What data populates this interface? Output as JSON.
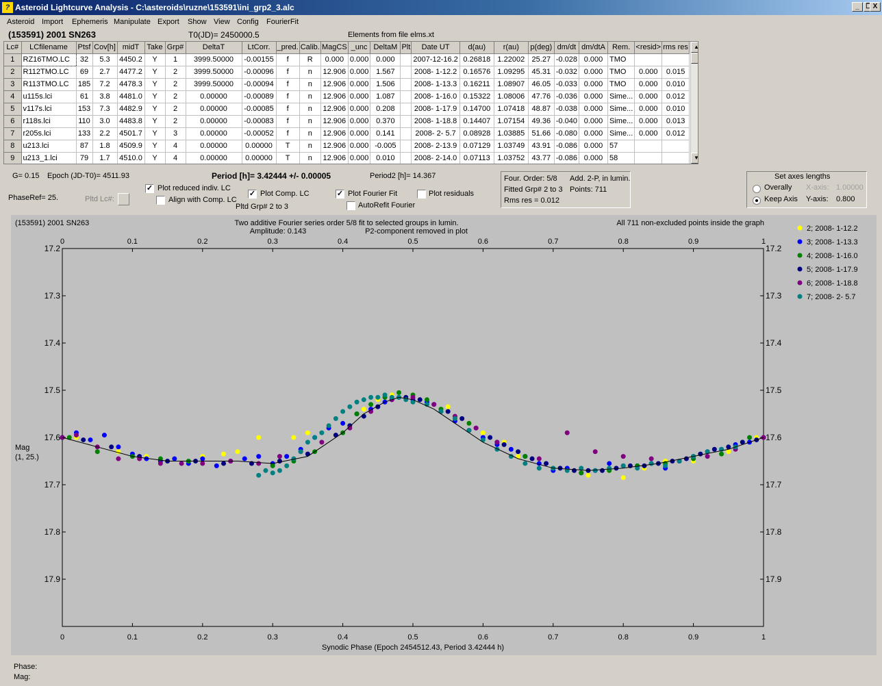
{
  "window": {
    "title": "Asteroid Lightcurve Analysis - C:\\asteroids\\ruzne\\153591\\ini_grp2_3.alc",
    "minimize": "_",
    "restore": "❐",
    "close": "X"
  },
  "menu": [
    "Asteroid",
    "Import",
    "Ephemeris",
    "Manipulate",
    "Export",
    "Show",
    "View",
    "Config",
    "FourierFit"
  ],
  "header": {
    "object": "(153591) 2001 SN263",
    "t0": "T0(JD)= 2450000.5",
    "elements": "Elements from file elms.xt"
  },
  "table": {
    "columns": [
      "Lc#",
      "LCfilename",
      "Ptsf",
      "Cov[h]",
      "midT",
      "Take",
      "Grp#",
      "DeltaT",
      "LtCorr.",
      "_pred.",
      "Calib.",
      "MagCS",
      "_unc",
      "DeltaM",
      "Plt",
      "Date UT",
      "d(au)",
      "r(au)",
      "p(deg)",
      "dm/dt",
      "dm/dtA",
      "Rem.",
      "<resid>",
      "rms res"
    ],
    "rows": [
      [
        "1",
        "RZ16TMO.LC",
        "32",
        "5.3",
        "4450.2",
        "Y",
        "1",
        "3999.50000",
        "-0.00155",
        "f",
        "R",
        "0.000",
        "0.000",
        "0.000",
        "",
        "2007-12-16.2",
        "0.26818",
        "1.22002",
        "25.27",
        "-0.028",
        "0.000",
        "TMO",
        "",
        ""
      ],
      [
        "2",
        "R112TMO.LC",
        "69",
        "2.7",
        "4477.2",
        "Y",
        "2",
        "3999.50000",
        "-0.00096",
        "f",
        "n",
        "12.906",
        "0.000",
        "1.567",
        "",
        "2008- 1-12.2",
        "0.16576",
        "1.09295",
        "45.31",
        "-0.032",
        "0.000",
        "TMO",
        "0.000",
        "0.015"
      ],
      [
        "3",
        "R113TMO.LC",
        "185",
        "7.2",
        "4478.3",
        "Y",
        "2",
        "3999.50000",
        "-0.00094",
        "f",
        "n",
        "12.906",
        "0.000",
        "1.506",
        "",
        "2008- 1-13.3",
        "0.16211",
        "1.08907",
        "46.05",
        "-0.033",
        "0.000",
        "TMO",
        "0.000",
        "0.010"
      ],
      [
        "4",
        "u115s.lci",
        "61",
        "3.8",
        "4481.0",
        "Y",
        "2",
        "0.00000",
        "-0.00089",
        "f",
        "n",
        "12.906",
        "0.000",
        "1.087",
        "",
        "2008- 1-16.0",
        "0.15322",
        "1.08006",
        "47.76",
        "-0.036",
        "0.000",
        "Sime...",
        "0.000",
        "0.012"
      ],
      [
        "5",
        "v117s.lci",
        "153",
        "7.3",
        "4482.9",
        "Y",
        "2",
        "0.00000",
        "-0.00085",
        "f",
        "n",
        "12.906",
        "0.000",
        "0.208",
        "",
        "2008- 1-17.9",
        "0.14700",
        "1.07418",
        "48.87",
        "-0.038",
        "0.000",
        "Sime...",
        "0.000",
        "0.010"
      ],
      [
        "6",
        "r118s.lci",
        "110",
        "3.0",
        "4483.8",
        "Y",
        "2",
        "0.00000",
        "-0.00083",
        "f",
        "n",
        "12.906",
        "0.000",
        "0.370",
        "",
        "2008- 1-18.8",
        "0.14407",
        "1.07154",
        "49.36",
        "-0.040",
        "0.000",
        "Sime...",
        "0.000",
        "0.013"
      ],
      [
        "7",
        "r205s.lci",
        "133",
        "2.2",
        "4501.7",
        "Y",
        "3",
        "0.00000",
        "-0.00052",
        "f",
        "n",
        "12.906",
        "0.000",
        "0.141",
        "",
        "2008- 2- 5.7",
        "0.08928",
        "1.03885",
        "51.66",
        "-0.080",
        "0.000",
        "Sime...",
        "0.000",
        "0.012"
      ],
      [
        "8",
        "u213.lci",
        "87",
        "1.8",
        "4509.9",
        "Y",
        "4",
        "0.00000",
        "0.00000",
        "T",
        "n",
        "12.906",
        "0.000",
        "-0.005",
        "",
        "2008- 2-13.9",
        "0.07129",
        "1.03749",
        "43.91",
        "-0.086",
        "0.000",
        "57",
        "",
        ""
      ],
      [
        "9",
        "u213_1.lci",
        "79",
        "1.7",
        "4510.0",
        "Y",
        "4",
        "0.00000",
        "0.00000",
        "T",
        "n",
        "12.906",
        "0.000",
        "0.010",
        "",
        "2008- 2-14.0",
        "0.07113",
        "1.03752",
        "43.77",
        "-0.086",
        "0.000",
        "58",
        "",
        ""
      ]
    ],
    "scroll_up": "▲",
    "scroll_down": "▼"
  },
  "info": {
    "g": "G= 0.15",
    "epoch": "Epoch (JD-T0)= 4511.93",
    "period": "Period [h]= 3.42444 +/- 0.00005",
    "period2": "Period2 [h]= 14.367",
    "phaseref": "PhaseRef= 25.",
    "pltd_lc": "Pltd Lc#:",
    "pltd_grp": "Pltd Grp#  2  to  3"
  },
  "options": {
    "plot_reduced": {
      "label": "Plot reduced indiv. LC",
      "checked": true
    },
    "align_comp": {
      "label": "Align with Comp. LC",
      "checked": false
    },
    "plot_comp": {
      "label": "Plot Comp. LC",
      "checked": true
    },
    "plot_fourier": {
      "label": "Plot Fourier Fit",
      "checked": true
    },
    "autorefit": {
      "label": "AutoRefit Fourier",
      "checked": false
    },
    "plot_residuals": {
      "label": "Plot residuals",
      "checked": false
    }
  },
  "fourier": {
    "order": "Four. Order:  5/8",
    "add2p": "Add. 2-P, in lumin.",
    "fitted": "Fitted Grp# 2 to 3",
    "points": "Points: 711",
    "rms": "Rms res     = 0.012"
  },
  "axes": {
    "title": "Set axes lengths",
    "overally": "Overally",
    "keep_axis": "Keep Axis",
    "selected": "keep_axis",
    "xaxis_label": "X-axis:",
    "xaxis_value": "1.00000",
    "yaxis_label": "Y-axis:",
    "yaxis_value": "0.800"
  },
  "status": {
    "phase": "Phase:",
    "mag": "Mag:"
  },
  "chart_data": {
    "type": "scatter",
    "object_label": "(153591) 2001 SN263",
    "subtitle1": "Two additive Fourier series order 5/8 fit to selected groups in lumin.",
    "amplitude": "Amplitude: 0.143",
    "subtitle2": "P2-component removed in plot",
    "points_note": "All 711 non-excluded points inside the graph",
    "xlabel": "Synodic Phase (Epoch 2454512.43, Period 3.42444 h)",
    "ylabel": "Mag",
    "ylabel2": "(1, 25.)",
    "xlim": [
      0.0,
      1.0
    ],
    "ylim": [
      17.2,
      18.0
    ],
    "y_inverted": true,
    "xticks": [
      0.0,
      0.1,
      0.2,
      0.3,
      0.4,
      0.5,
      0.6,
      0.7,
      0.8,
      0.9,
      1.0
    ],
    "yticks": [
      17.2,
      17.3,
      17.4,
      17.5,
      17.6,
      17.7,
      17.8,
      17.9
    ],
    "legend_position": "right",
    "fit_curve": {
      "x": [
        0.0,
        0.05,
        0.1,
        0.15,
        0.2,
        0.25,
        0.3,
        0.35,
        0.4,
        0.43,
        0.46,
        0.48,
        0.5,
        0.53,
        0.56,
        0.6,
        0.65,
        0.7,
        0.75,
        0.8,
        0.85,
        0.9,
        0.95,
        1.0
      ],
      "y": [
        17.6,
        17.62,
        17.64,
        17.65,
        17.65,
        17.65,
        17.655,
        17.64,
        17.59,
        17.55,
        17.525,
        17.515,
        17.52,
        17.54,
        17.57,
        17.61,
        17.645,
        17.665,
        17.67,
        17.665,
        17.655,
        17.64,
        17.625,
        17.6
      ],
      "color": "#000000"
    },
    "series": [
      {
        "name": "2; 2008- 1-12.2",
        "color": "#ffff00",
        "x": [
          0.02,
          0.08,
          0.12,
          0.16,
          0.2,
          0.23,
          0.25,
          0.28,
          0.33,
          0.35,
          0.38,
          0.4,
          0.43,
          0.45,
          0.47,
          0.49,
          0.55,
          0.58,
          0.6,
          0.63,
          0.65,
          0.7,
          0.75,
          0.78,
          0.8,
          0.83,
          0.86,
          0.9,
          0.95,
          0.99
        ],
        "y": [
          17.6,
          17.63,
          17.64,
          17.645,
          17.64,
          17.635,
          17.63,
          17.6,
          17.6,
          17.59,
          17.575,
          17.57,
          17.54,
          17.52,
          17.51,
          17.515,
          17.535,
          17.57,
          17.59,
          17.61,
          17.64,
          17.665,
          17.68,
          17.67,
          17.685,
          17.665,
          17.65,
          17.65,
          17.63,
          17.6
        ]
      },
      {
        "name": "3; 2008- 1-13.3",
        "color": "#0000ff",
        "x": [
          0.0,
          0.02,
          0.04,
          0.06,
          0.08,
          0.1,
          0.12,
          0.14,
          0.16,
          0.18,
          0.2,
          0.22,
          0.24,
          0.26,
          0.28,
          0.3,
          0.32,
          0.34,
          0.36,
          0.38,
          0.4,
          0.42,
          0.44,
          0.46,
          0.48,
          0.5,
          0.52,
          0.54,
          0.56,
          0.58,
          0.6,
          0.62,
          0.64,
          0.66,
          0.68,
          0.7,
          0.72,
          0.74,
          0.76,
          0.78,
          0.8,
          0.82,
          0.84,
          0.86,
          0.88,
          0.9,
          0.92,
          0.94,
          0.96,
          0.98,
          1.0
        ],
        "y": [
          17.6,
          17.59,
          17.605,
          17.595,
          17.62,
          17.635,
          17.645,
          17.65,
          17.645,
          17.655,
          17.645,
          17.66,
          17.65,
          17.645,
          17.64,
          17.655,
          17.64,
          17.625,
          17.6,
          17.58,
          17.57,
          17.55,
          17.54,
          17.525,
          17.515,
          17.52,
          17.525,
          17.545,
          17.565,
          17.585,
          17.6,
          17.615,
          17.625,
          17.64,
          17.655,
          17.67,
          17.665,
          17.675,
          17.67,
          17.655,
          17.66,
          17.66,
          17.655,
          17.665,
          17.65,
          17.64,
          17.63,
          17.625,
          17.615,
          17.61,
          17.6
        ]
      },
      {
        "name": "4; 2008- 1-16.0",
        "color": "#008000",
        "x": [
          0.01,
          0.05,
          0.1,
          0.14,
          0.18,
          0.3,
          0.33,
          0.36,
          0.4,
          0.42,
          0.44,
          0.46,
          0.48,
          0.5,
          0.52,
          0.54,
          0.58,
          0.62,
          0.66,
          0.7,
          0.74,
          0.78,
          0.82,
          0.86,
          0.9,
          0.94,
          0.98
        ],
        "y": [
          17.6,
          17.63,
          17.64,
          17.645,
          17.65,
          17.66,
          17.65,
          17.63,
          17.59,
          17.55,
          17.53,
          17.515,
          17.505,
          17.51,
          17.52,
          17.54,
          17.57,
          17.61,
          17.64,
          17.665,
          17.675,
          17.67,
          17.66,
          17.655,
          17.645,
          17.635,
          17.6
        ]
      },
      {
        "name": "5; 2008- 1-17.9",
        "color": "#000080",
        "x": [
          0.0,
          0.03,
          0.07,
          0.11,
          0.15,
          0.19,
          0.23,
          0.27,
          0.31,
          0.35,
          0.39,
          0.41,
          0.43,
          0.45,
          0.47,
          0.49,
          0.51,
          0.53,
          0.55,
          0.57,
          0.59,
          0.61,
          0.63,
          0.65,
          0.67,
          0.69,
          0.71,
          0.73,
          0.75,
          0.77,
          0.79,
          0.81,
          0.83,
          0.85,
          0.87,
          0.89,
          0.91,
          0.93,
          0.95,
          0.97,
          0.99
        ],
        "y": [
          17.6,
          17.605,
          17.62,
          17.64,
          17.65,
          17.65,
          17.655,
          17.655,
          17.65,
          17.635,
          17.595,
          17.575,
          17.555,
          17.535,
          17.52,
          17.515,
          17.52,
          17.53,
          17.545,
          17.56,
          17.58,
          17.6,
          17.615,
          17.63,
          17.645,
          17.655,
          17.665,
          17.67,
          17.67,
          17.67,
          17.665,
          17.66,
          17.66,
          17.655,
          17.65,
          17.645,
          17.635,
          17.625,
          17.62,
          17.61,
          17.605
        ]
      },
      {
        "name": "6; 2008- 1-18.8",
        "color": "#800080",
        "x": [
          0.0,
          0.02,
          0.05,
          0.08,
          0.11,
          0.14,
          0.17,
          0.2,
          0.24,
          0.28,
          0.31,
          0.34,
          0.37,
          0.41,
          0.44,
          0.47,
          0.5,
          0.53,
          0.56,
          0.59,
          0.62,
          0.68,
          0.72,
          0.76,
          0.8,
          0.84,
          0.88,
          0.92,
          0.96,
          1.0
        ],
        "y": [
          17.6,
          17.595,
          17.62,
          17.645,
          17.645,
          17.655,
          17.655,
          17.655,
          17.65,
          17.655,
          17.64,
          17.63,
          17.61,
          17.58,
          17.545,
          17.52,
          17.515,
          17.53,
          17.555,
          17.58,
          17.61,
          17.645,
          17.59,
          17.63,
          17.64,
          17.645,
          17.65,
          17.64,
          17.625,
          17.6
        ]
      },
      {
        "name": "7; 2008- 2- 5.7",
        "color": "#008080",
        "x": [
          0.28,
          0.29,
          0.3,
          0.31,
          0.32,
          0.33,
          0.34,
          0.35,
          0.36,
          0.37,
          0.38,
          0.39,
          0.4,
          0.41,
          0.42,
          0.43,
          0.44,
          0.45,
          0.46,
          0.47,
          0.48,
          0.49,
          0.5,
          0.52,
          0.54,
          0.56,
          0.58,
          0.6,
          0.62,
          0.64,
          0.66,
          0.68,
          0.7,
          0.72,
          0.74,
          0.76,
          0.78,
          0.8,
          0.82,
          0.84,
          0.86,
          0.88,
          0.9,
          0.92,
          0.94,
          0.96
        ],
        "y": [
          17.68,
          17.67,
          17.675,
          17.67,
          17.66,
          17.645,
          17.63,
          17.61,
          17.6,
          17.59,
          17.575,
          17.56,
          17.545,
          17.535,
          17.525,
          17.52,
          17.515,
          17.515,
          17.51,
          17.515,
          17.515,
          17.52,
          17.525,
          17.53,
          17.545,
          17.56,
          17.585,
          17.605,
          17.625,
          17.64,
          17.655,
          17.665,
          17.665,
          17.67,
          17.665,
          17.67,
          17.665,
          17.66,
          17.665,
          17.655,
          17.66,
          17.65,
          17.64,
          17.63,
          17.625,
          17.62
        ]
      }
    ]
  }
}
